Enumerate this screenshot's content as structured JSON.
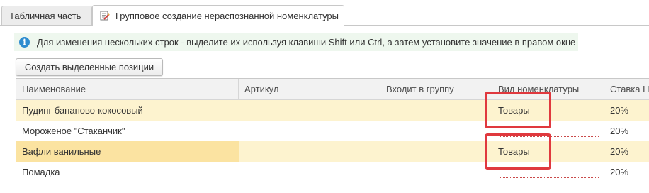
{
  "tabs": [
    {
      "label": "Табличная часть",
      "active": false
    },
    {
      "label": "Групповое создание нераспознанной номенклатуры",
      "active": true
    }
  ],
  "info": {
    "text": "Для изменения нескольких строк - выделите их используя клавиши Shift или Ctrl, а затем установите значение в правом окне"
  },
  "toolbar": {
    "create_label": "Создать выделенные позиции"
  },
  "table": {
    "columns": [
      "Наименование",
      "Артикул",
      "Входит в группу",
      "Вид номенклатуры",
      "Ставка НДС"
    ],
    "rows": [
      {
        "name": "Пудинг бананово-кокосовый",
        "article": "",
        "group": "",
        "kind": "Товары",
        "vat": "20%"
      },
      {
        "name": "Мороженое \"Стаканчик\"",
        "article": "",
        "group": "",
        "kind": "",
        "vat": "20%"
      },
      {
        "name": "Вафли ванильные",
        "article": "",
        "group": "",
        "kind": "Товары",
        "vat": "20%"
      },
      {
        "name": "Помадка",
        "article": "",
        "group": "",
        "kind": "",
        "vat": "20%"
      }
    ]
  },
  "colors": {
    "row_highlight": "#fdf3cf",
    "selected_cell": "#fbe3a1",
    "annotation_box": "#e0393e",
    "info_icon": "#2e8ccf"
  }
}
